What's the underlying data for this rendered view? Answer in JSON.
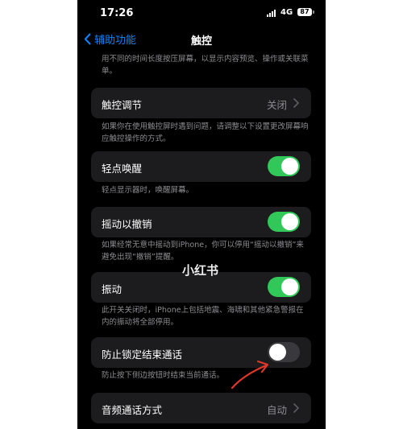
{
  "status_bar": {
    "time": "17:26",
    "network": "4G",
    "battery": "87"
  },
  "nav": {
    "back_label": "辅助功能",
    "title": "触控"
  },
  "top_footer": "用不同的时间长度按压屏幕，以显示内容预览、操作或关联菜单。",
  "settings": [
    {
      "label": "触控调节",
      "value": "关闭",
      "type": "disclosure",
      "footer": "如果你在使用触控屏时遇到问题，请调整以下设置更改屏幕响应触控操作的方式。"
    },
    {
      "label": "轻点唤醒",
      "on": true,
      "type": "toggle",
      "footer": "轻点显示器时，唤醒屏幕。"
    },
    {
      "label": "摇动以撤销",
      "on": true,
      "type": "toggle",
      "footer": "如果经常无意中摇动到iPhone，你可以停用“摇动以撤销”来避免出现“撤销”提醒。"
    },
    {
      "label": "振动",
      "on": true,
      "type": "toggle",
      "footer": "此开关关闭时，iPhone上包括地震、海啸和其他紧急警报在内的振动将全部停用。"
    },
    {
      "label": "防止锁定结束通话",
      "on": false,
      "type": "toggle",
      "footer": "防止按下侧边按钮时结束当前通话。"
    },
    {
      "label": "音频通话方式",
      "value": "自动",
      "type": "disclosure",
      "footer": ""
    }
  ],
  "watermark": "小红书",
  "colors": {
    "accent": "#0a84ff",
    "toggle_on": "#32c759",
    "annotation": "#e0372b",
    "background": "#000000",
    "cell": "#1c1c1e"
  }
}
